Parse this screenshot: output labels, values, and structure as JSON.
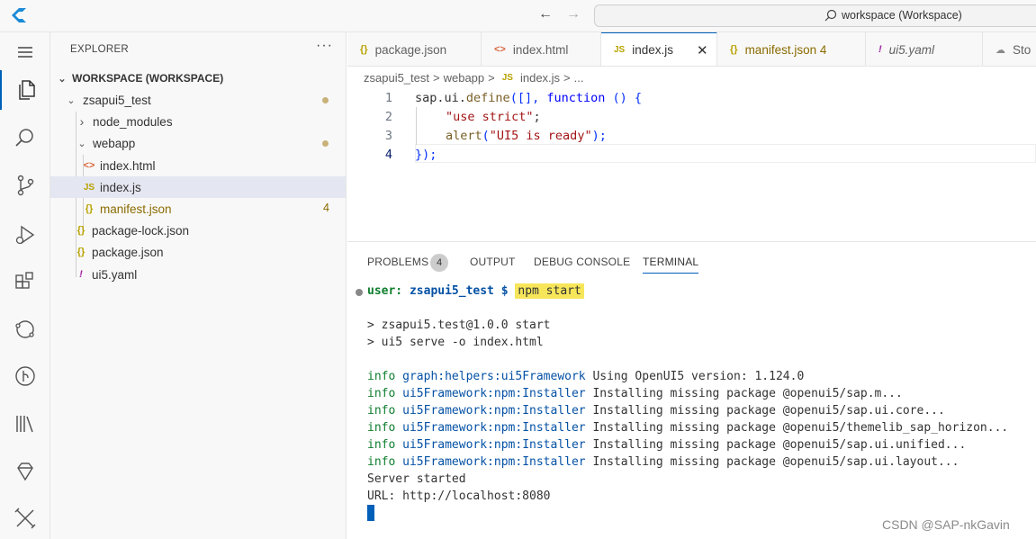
{
  "titlebar": {
    "search_text": "workspace (Workspace)"
  },
  "activity_bar": {
    "items": [
      "explorer-icon",
      "search-icon",
      "source-control-icon",
      "run-debug-icon",
      "extensions-icon",
      "remote-icon",
      "git-graph-icon",
      "library-icon",
      "gem-icon",
      "tools-icon"
    ]
  },
  "sidebar": {
    "header": "EXPLORER",
    "more": "···",
    "tree": [
      {
        "label": "WORKSPACE (WORKSPACE)",
        "chevron": "⌄",
        "icon": ""
      },
      {
        "label": "zsapui5_test",
        "chevron": "⌄",
        "icon": ""
      },
      {
        "label": "node_modules",
        "chevron": "›",
        "icon": ""
      },
      {
        "label": "webapp",
        "chevron": "⌄",
        "icon": ""
      },
      {
        "label": "index.html",
        "chevron": "",
        "icon": "<>"
      },
      {
        "label": "index.js",
        "chevron": "",
        "icon": "JS"
      },
      {
        "label": "manifest.json",
        "chevron": "",
        "icon": "{}",
        "count": "4"
      },
      {
        "label": "package-lock.json",
        "chevron": "",
        "icon": "{}"
      },
      {
        "label": "package.json",
        "chevron": "",
        "icon": "{}"
      },
      {
        "label": "ui5.yaml",
        "chevron": "",
        "icon": "!"
      }
    ]
  },
  "tabs": [
    {
      "icon": "{}",
      "label": "package.json"
    },
    {
      "icon": "<>",
      "label": "index.html"
    },
    {
      "icon": "JS",
      "label": "index.js",
      "close": "✕"
    },
    {
      "icon": "{}",
      "label": "manifest.json 4"
    },
    {
      "icon": "!",
      "label": "ui5.yaml"
    },
    {
      "icon": "☁",
      "label": "Sto"
    }
  ],
  "breadcrumb": [
    "zsapui5_test",
    ">",
    "webapp",
    ">",
    "JS",
    "index.js",
    ">",
    "..."
  ],
  "editor": {
    "lines": [
      "1",
      "2",
      "3",
      "4"
    ],
    "code": {
      "l1_a": "sap.ui.",
      "l1_b": "define",
      "l1_c": "([], ",
      "l1_d": "function",
      "l1_e": " () {",
      "l2": "\"use strict\"",
      "l2_end": ";",
      "l3_a": "alert",
      "l3_b": "(",
      "l3_c": "\"UI5 is ready\"",
      "l3_d": ");",
      "l4": "});"
    }
  },
  "panel": {
    "tabs": [
      "PROBLEMS",
      "OUTPUT",
      "DEBUG CONSOLE",
      "TERMINAL"
    ],
    "problems_count": "4",
    "prompt_user": "user:",
    "prompt_dir": "zsapui5_test $",
    "command": "npm start",
    "output": [
      "> zsapui5.test@1.0.0 start",
      "> ui5 serve -o index.html"
    ],
    "info_lines": [
      {
        "tag": "info",
        "ns": "graph:helpers:ui5Framework",
        "msg": " Using OpenUI5 version: 1.124.0"
      },
      {
        "tag": "info",
        "ns": "ui5Framework:npm:Installer",
        "msg": " Installing missing package @openui5/sap.m..."
      },
      {
        "tag": "info",
        "ns": "ui5Framework:npm:Installer",
        "msg": " Installing missing package @openui5/sap.ui.core..."
      },
      {
        "tag": "info",
        "ns": "ui5Framework:npm:Installer",
        "msg": " Installing missing package @openui5/themelib_sap_horizon..."
      },
      {
        "tag": "info",
        "ns": "ui5Framework:npm:Installer",
        "msg": " Installing missing package @openui5/sap.ui.unified..."
      },
      {
        "tag": "info",
        "ns": "ui5Framework:npm:Installer",
        "msg": " Installing missing package @openui5/sap.ui.layout..."
      }
    ],
    "server_started": "Server started",
    "url_line": "URL: http://localhost:8080"
  },
  "watermark": "CSDN @SAP-nkGavin",
  "colors": {
    "accent": "#005fb8",
    "info": "#0f7e2e",
    "namespace": "#0451a5",
    "highlight": "#f7e65a"
  }
}
